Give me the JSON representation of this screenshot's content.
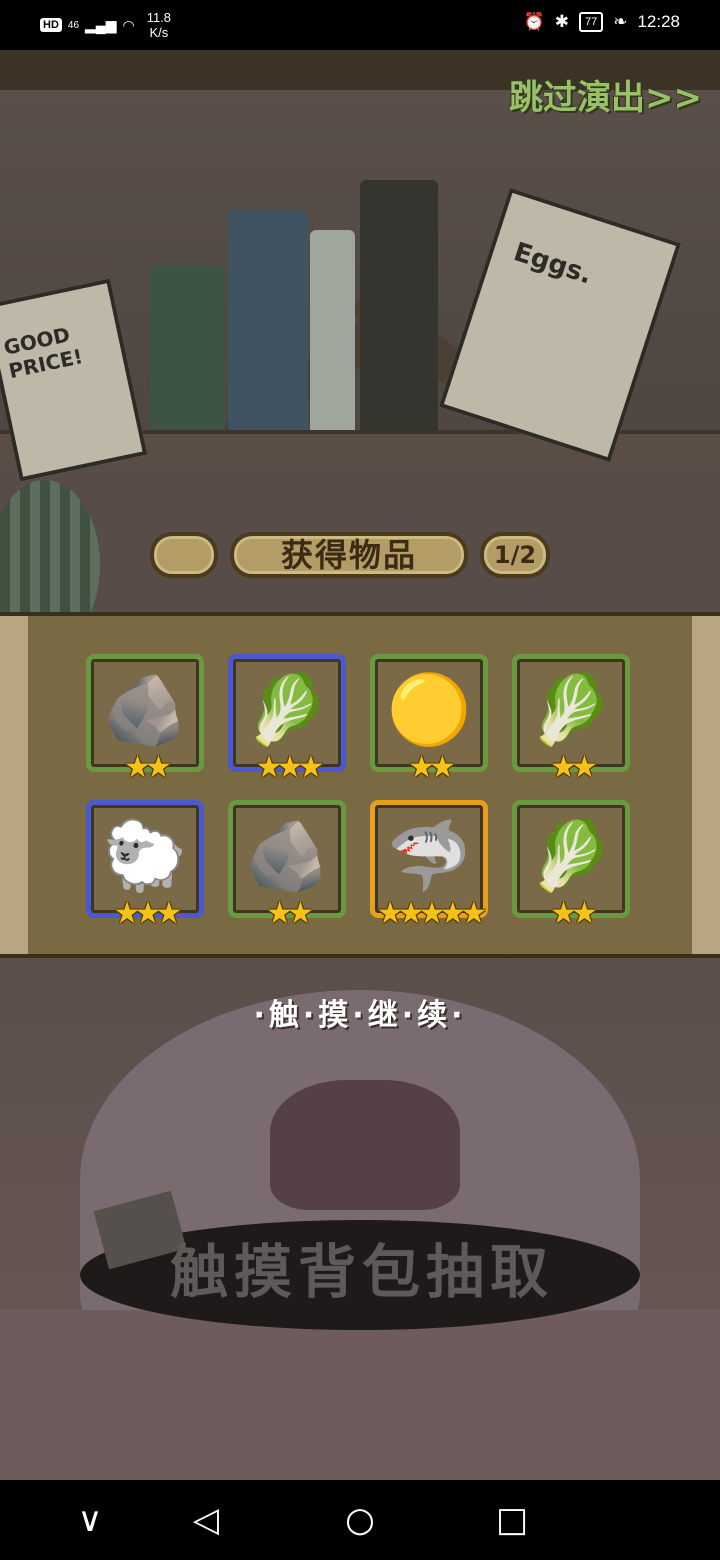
{
  "status_bar": {
    "hd": "HD",
    "network": "46",
    "speed_value": "11.8",
    "speed_unit": "K/s",
    "battery": "77",
    "time": "12:28"
  },
  "header": {
    "skip_label": "跳过演出>>"
  },
  "notes": {
    "left_text": "GOOD PRICE!",
    "right_text": "Eggs."
  },
  "rewards": {
    "title": "获得物品",
    "page": "1/2",
    "items": [
      {
        "icon": "rock-icon",
        "art": "🪨",
        "rarity": 2,
        "stars": "★★",
        "frame": "green"
      },
      {
        "icon": "seed-pod-icon",
        "art": "🥬",
        "rarity": 3,
        "stars": "★★★",
        "frame": "blue"
      },
      {
        "icon": "golden-slime-icon",
        "art": "🟡",
        "rarity": 2,
        "stars": "★★",
        "frame": "green"
      },
      {
        "icon": "radish-icon",
        "art": "🥬",
        "rarity": 2,
        "stars": "★★",
        "frame": "green"
      },
      {
        "icon": "fluffy-bee-icon",
        "art": "🐑",
        "rarity": 3,
        "stars": "★★★",
        "frame": "blue"
      },
      {
        "icon": "rock-icon",
        "art": "🪨",
        "rarity": 2,
        "stars": "★★",
        "frame": "green"
      },
      {
        "icon": "blue-monster-icon",
        "art": "🦈",
        "rarity": 5,
        "stars": "★★★★★",
        "frame": "gold"
      },
      {
        "icon": "radish-icon",
        "art": "🥬",
        "rarity": 2,
        "stars": "★★",
        "frame": "green"
      }
    ]
  },
  "continue_label": "·触·摸·继·续·",
  "draw_label": "触摸背包抽取",
  "nav": {
    "back_icon": "◁",
    "home_icon": "○",
    "recent_icon": "□",
    "down_icon": "∨"
  },
  "colors": {
    "frame_green": "#6a9a3f",
    "frame_blue": "#4a58d1",
    "frame_gold": "#e6a019",
    "skip_green": "#9bc06a",
    "star": "#f5c21a"
  }
}
